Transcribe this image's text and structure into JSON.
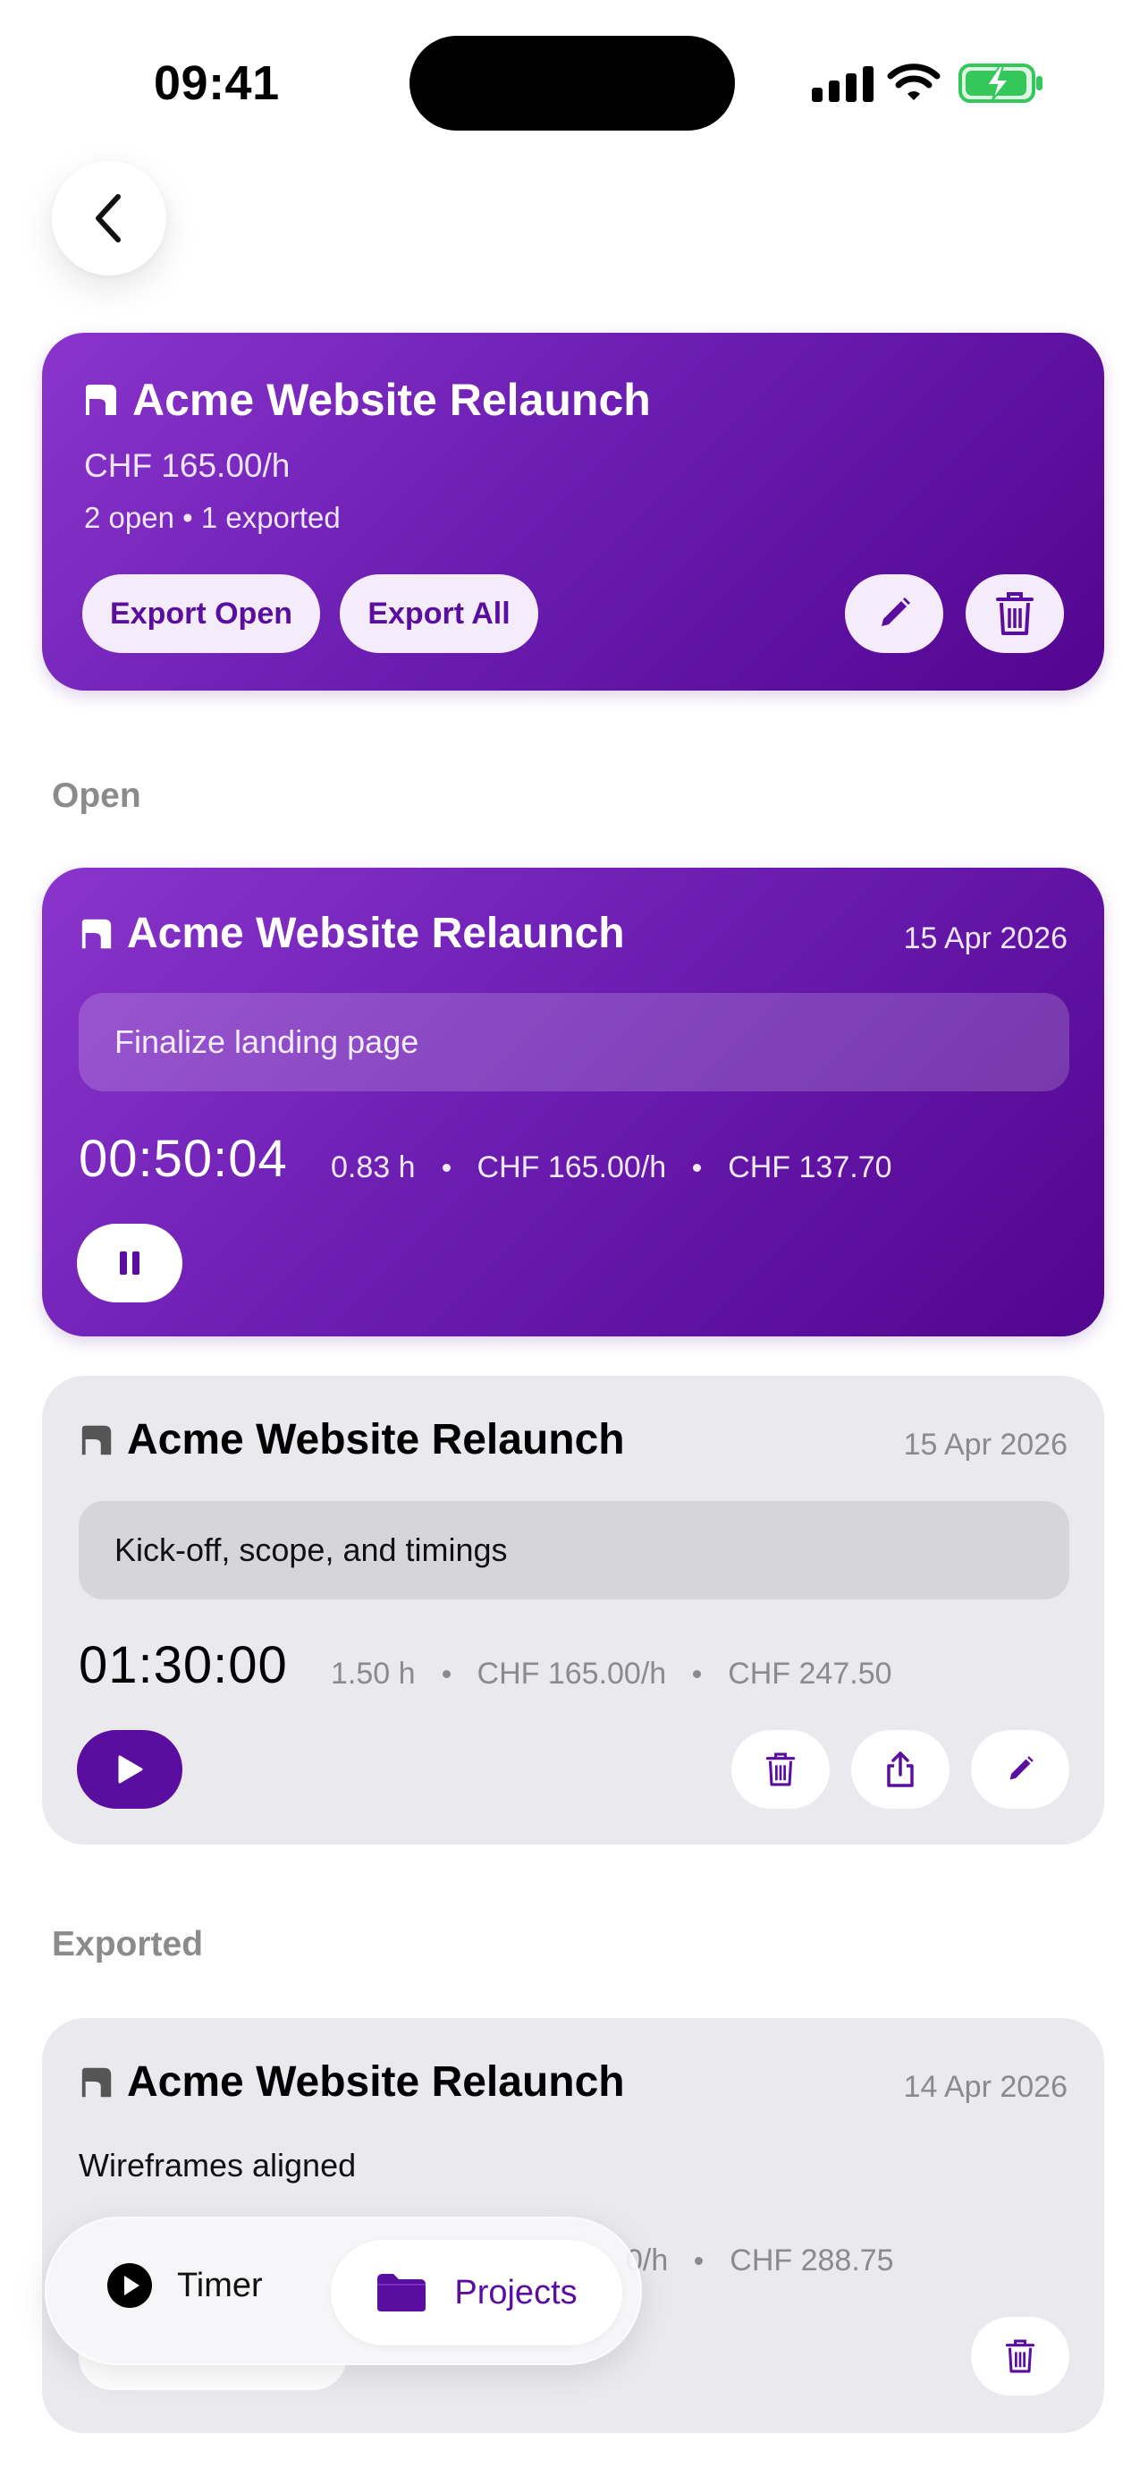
{
  "status_bar": {
    "time": "09:41"
  },
  "project": {
    "title": "Acme Website Relaunch",
    "rate": "CHF 165.00/h",
    "counts": "2 open • 1 exported",
    "export_open_label": "Export Open",
    "export_all_label": "Export All"
  },
  "sections": {
    "open": "Open",
    "exported": "Exported"
  },
  "entries": [
    {
      "title": "Acme Website Relaunch",
      "date": "15 Apr 2026",
      "description": "Finalize landing page",
      "duration": "00:50:04",
      "hours": "0.83 h",
      "rate": "CHF 165.00/h",
      "amount": "CHF 137.70",
      "state": "running"
    },
    {
      "title": "Acme Website Relaunch",
      "date": "15 Apr 2026",
      "description": "Kick-off, scope, and timings",
      "duration": "01:30:00",
      "hours": "1.50 h",
      "rate": "CHF 165.00/h",
      "amount": "CHF 247.50",
      "state": "paused"
    },
    {
      "title": "Acme Website Relaunch",
      "date": "14 Apr 2026",
      "description": "Wireframes aligned",
      "rate_partial": "0/h",
      "amount": "CHF 288.75",
      "state": "exported"
    }
  ],
  "tabbar": {
    "timer_label": "Timer",
    "projects_label": "Projects"
  },
  "colors": {
    "accent": "#5a0ea0",
    "gradient_start": "#8a34cc",
    "gradient_end": "#52058f",
    "card_grey": "#e9e9ee",
    "battery_green": "#34c759"
  },
  "icons": {
    "back": "chevron-left-icon",
    "project": "bookmark-icon",
    "edit": "pencil-icon",
    "delete": "trash-icon",
    "share": "share-icon",
    "pause": "pause-icon",
    "play": "play-icon",
    "folder": "folder-icon"
  }
}
